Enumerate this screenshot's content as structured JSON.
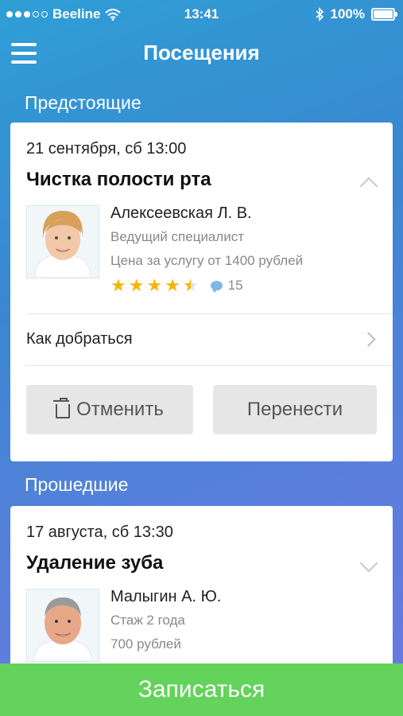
{
  "status_bar": {
    "carrier": "Beeline",
    "time": "13:41",
    "battery": "100%"
  },
  "nav": {
    "title": "Посещения"
  },
  "sections": {
    "upcoming_label": "Предстоящие",
    "past_label": "Прошедшие"
  },
  "upcoming": {
    "date": "21 сентября, сб 13:00",
    "service": "Чистка полости рта",
    "doctor": {
      "name": "Алексеевская Л. В.",
      "position": "Ведущий специалист",
      "price": "Цена за услугу от 1400 рублей",
      "rating": 4.5,
      "reviews": "15"
    },
    "directions_label": "Как добраться",
    "cancel_label": "Отменить",
    "reschedule_label": "Перенести"
  },
  "past": {
    "date": "17 августа, сб 13:30",
    "service": "Удаление зуба",
    "doctor": {
      "name": "Малыгин А. Ю.",
      "experience": "Стаж 2 года",
      "price": "700 рублей"
    }
  },
  "book_button_label": "Записаться"
}
